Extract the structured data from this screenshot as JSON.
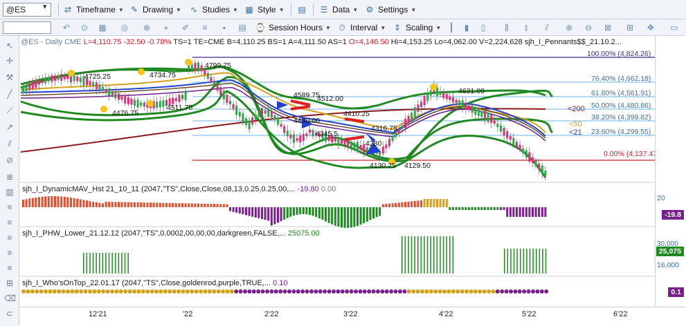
{
  "toolbar": {
    "symbol": "@ES",
    "timeframe": "Timeframe",
    "drawing": "Drawing",
    "studies": "Studies",
    "style": "Style",
    "data": "Data",
    "settings": "Settings"
  },
  "toolbar2": {
    "session_hours": "Session Hours",
    "interval": "Interval",
    "scaling": "Scaling"
  },
  "header": {
    "symbol": "@ES - Daily",
    "exchange": "CME",
    "last": "L=4,110.75",
    "change": "-32.50",
    "pct": "-0.78%",
    "ts": "TS=1",
    "te": "TE=CME",
    "bid": "B=4,110.25",
    "bs": "BS=1",
    "ask": "A=4,111.50",
    "as": "AS=1",
    "open": "O=4,146.50",
    "high": "Hi=4,153.25",
    "low": "Lo=4,062.00",
    "volume": "V=2,224,628",
    "study": "sjh_I_Pennants$$_21.10.2..."
  },
  "fib_levels": [
    {
      "label": "100.00% (4,824.26)"
    },
    {
      "label": "76.40% (4,662.18)"
    },
    {
      "label": "61.80% (4,561.91)"
    },
    {
      "label": "50.00% (4,480.86)"
    },
    {
      "label": "38.20% (4,399.82)"
    },
    {
      "label": "23.60% (4,299.55)"
    },
    {
      "label": "0.00% (4,137.47)"
    }
  ],
  "ma_labels": {
    "ma200": "<200",
    "ma50": "<50",
    "ma21": "<21"
  },
  "annotations": {
    "a1": "4725.25",
    "a2": "4734.75",
    "a3": "4799.75",
    "a4": "4476.75",
    "a5": "4511.75",
    "a6": "4589.75",
    "a7": "4512.00",
    "a8": "4430.00",
    "a9": "4345.5",
    "a10": "4410.25",
    "a11": "4316.75",
    "a12": "4280",
    "a13": "4130.25",
    "a14": "4129.50",
    "a15": "4631.00"
  },
  "indicators": {
    "dmav": {
      "name": "sjh_I_DynamicMAV_Hst 21_10_11 (2047,\"TS\",Close,Close,08,13,0.25,0.25,00,...",
      "v1": "-19.80",
      "v2": "0.00",
      "axis_top": "20",
      "tag": "-19.8"
    },
    "phw": {
      "name": "sjh_I_PHW_Lower_21.12.12 (2047,\"TS\",0.0002,00,00,00,darkgreen,FALSE,...",
      "v1": "25075.00",
      "axis_top": "30,000",
      "tag": "25,075",
      "axis_bottom": "16,000"
    },
    "woot": {
      "name": "sjh_I_Who'sOnTop_22.01.17 (2047,\"TS\",Close,goldenrod,purple,TRUE,...",
      "v1": "0.10",
      "tag": "0.1"
    }
  },
  "xaxis": [
    "12'21",
    "'22",
    "2'22",
    "3'22",
    "4'22",
    "5'22",
    "6'22"
  ],
  "colors": {
    "accent": "#3a6ea5",
    "down": "#e0307a",
    "up": "#2ea84a",
    "gold": "#d4a017",
    "purple": "#7a1f8c"
  }
}
